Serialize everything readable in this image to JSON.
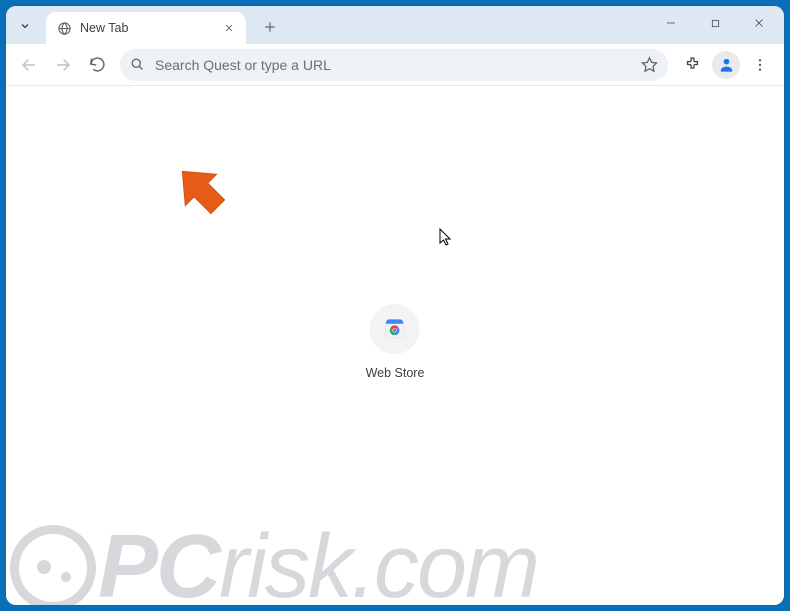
{
  "window": {
    "tab_title": "New Tab"
  },
  "toolbar": {
    "search_placeholder": "Search Quest or type a URL"
  },
  "content": {
    "shortcut_label": "Web Store"
  },
  "watermark": {
    "text_head": "PC",
    "text_tail": "risk.com"
  }
}
